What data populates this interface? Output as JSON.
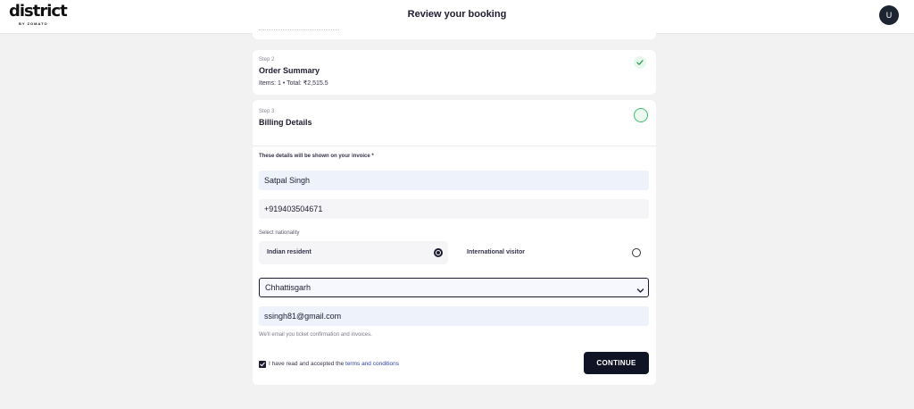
{
  "header": {
    "logo_text": "district",
    "logo_subtext": "BY ZOMATO",
    "title": "Review your booking",
    "avatar_initial": "U"
  },
  "steps": {
    "order_summary": {
      "kicker": "Step 2",
      "title": "Order Summary",
      "summary": "Items: 1 • Total: ₹2,515.5",
      "status": "completed"
    },
    "billing": {
      "kicker": "Step 3",
      "title": "Billing Details",
      "status": "in-progress"
    }
  },
  "form": {
    "note": "These details will be shown on your invoice *",
    "name_value": "Satpal Singh",
    "phone_value": "+919403504671",
    "nationality_label": "Select nationality",
    "nationality_options": [
      {
        "label": "Indian resident",
        "selected": true
      },
      {
        "label": "International visitor",
        "selected": false
      }
    ],
    "state_value": "Chhattisgarh",
    "email_value": "ssingh81@gmail.com",
    "email_help": "We'll email you ticket confirmation and invoices.",
    "terms_checked": true,
    "terms_prefix": "I have read and accepted the ",
    "terms_link": "terms and conditions",
    "continue_label": "CONTINUE"
  },
  "colors": {
    "page_bg": "#f2f2f2",
    "primary_dark": "#0f1424",
    "success_green": "#3fbf6a",
    "input_bg": "#edf2fb",
    "link_blue": "#2c3ea8"
  }
}
